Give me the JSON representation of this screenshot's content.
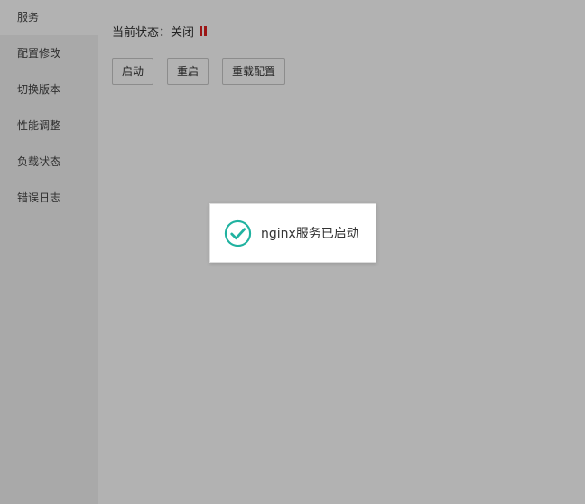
{
  "sidebar": {
    "items": [
      {
        "label": "服务",
        "active": true
      },
      {
        "label": "配置修改"
      },
      {
        "label": "切换版本"
      },
      {
        "label": "性能调整"
      },
      {
        "label": "负载状态"
      },
      {
        "label": "错误日志"
      }
    ]
  },
  "status": {
    "label": "当前状态：关闭",
    "icon": "pause-icon",
    "icon_color": "#e02020"
  },
  "actions": {
    "start_label": "启动",
    "restart_label": "重启",
    "reload_label": "重载配置"
  },
  "toast": {
    "icon": "check-circle-icon",
    "icon_color": "#20b2a0",
    "message": "nginx服务已启动"
  }
}
